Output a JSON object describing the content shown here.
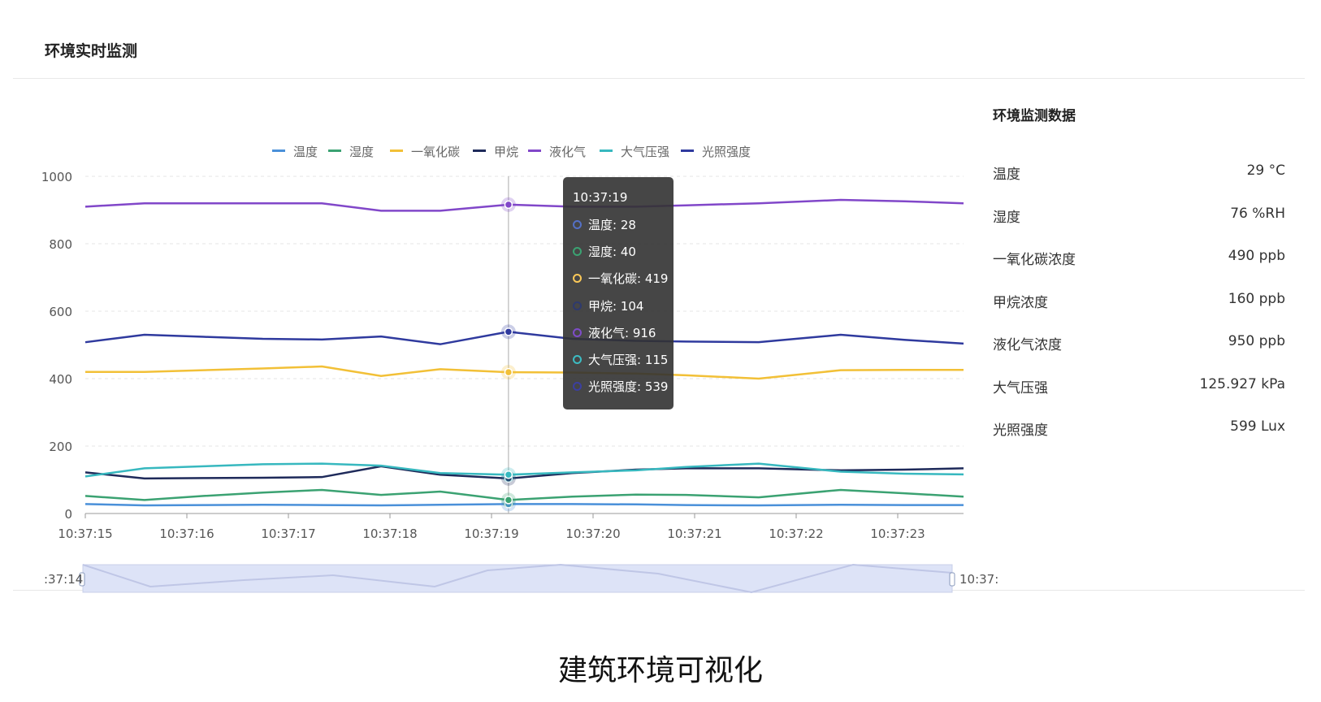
{
  "panel": {
    "title": "环境实时监测"
  },
  "caption": "建筑环境可视化",
  "side_panel": {
    "title": "环境监测数据",
    "rows": [
      {
        "label": "温度",
        "value": "29 °C"
      },
      {
        "label": "湿度",
        "value": "76 %RH"
      },
      {
        "label": "一氧化碳浓度",
        "value": "490 ppb"
      },
      {
        "label": "甲烷浓度",
        "value": "160 ppb"
      },
      {
        "label": "液化气浓度",
        "value": "950 ppb"
      },
      {
        "label": "大气压强",
        "value": "125.927 kPa"
      },
      {
        "label": "光照强度",
        "value": "599 Lux"
      }
    ]
  },
  "tooltip": {
    "time": "10:37:19",
    "rows": [
      {
        "text": "温度: 28",
        "color": "#5470c6"
      },
      {
        "text": "湿度: 40",
        "color": "#3ba272"
      },
      {
        "text": "一氧化碳: 419",
        "color": "#fac858"
      },
      {
        "text": "甲烷: 104",
        "color": "#2e3a6e"
      },
      {
        "text": "液化气: 916",
        "color": "#7e4cc9"
      },
      {
        "text": "大气压强: 115",
        "color": "#3cbcc3"
      },
      {
        "text": "光照强度: 539",
        "color": "#3b3fa0"
      }
    ]
  },
  "zoom": {
    "start_label": ":37:14",
    "end_label": "10:37:"
  },
  "chart_data": {
    "type": "line",
    "ylim": [
      0,
      1000
    ],
    "yticks": [
      0,
      200,
      400,
      600,
      800,
      1000
    ],
    "x": [
      0,
      0.65,
      1.3,
      1.95,
      2.6,
      3.25,
      3.9,
      4.65,
      5.35,
      6.05,
      6.6,
      7.4,
      8.3,
      9.0,
      9.65
    ],
    "xticks": [
      "10:37:15",
      "10:37:16",
      "10:37:17",
      "10:37:18",
      "10:37:19",
      "10:37:20",
      "10:37:21",
      "10:37:22",
      "10:37:23"
    ],
    "grid": true,
    "legend_position": "top-center",
    "series": [
      {
        "name": "温度",
        "color": "#4a90d9",
        "values": [
          28,
          24,
          25,
          26,
          25,
          24,
          26,
          28,
          28,
          27,
          25,
          24,
          26,
          25,
          25
        ]
      },
      {
        "name": "湿度",
        "color": "#3ba272",
        "values": [
          52,
          40,
          52,
          62,
          70,
          55,
          65,
          40,
          50,
          56,
          55,
          48,
          70,
          60,
          50
        ]
      },
      {
        "name": "一氧化碳",
        "color": "#f2c037",
        "values": [
          420,
          420,
          425,
          430,
          436,
          408,
          428,
          419,
          418,
          415,
          410,
          400,
          425,
          426,
          426
        ]
      },
      {
        "name": "甲烷",
        "color": "#1e2a5a",
        "values": [
          122,
          104,
          105,
          106,
          108,
          140,
          115,
          104,
          120,
          130,
          134,
          134,
          128,
          130,
          134
        ]
      },
      {
        "name": "液化气",
        "color": "#8147c9",
        "values": [
          910,
          920,
          920,
          920,
          920,
          898,
          898,
          916,
          910,
          910,
          914,
          920,
          930,
          926,
          920
        ]
      },
      {
        "name": "大气压强",
        "color": "#37b8bf",
        "values": [
          110,
          134,
          140,
          146,
          148,
          142,
          120,
          115,
          122,
          128,
          138,
          148,
          124,
          118,
          116
        ]
      },
      {
        "name": "光照强度",
        "color": "#2f3a9e",
        "values": [
          508,
          530,
          524,
          518,
          516,
          525,
          502,
          539,
          518,
          512,
          510,
          508,
          530,
          515,
          504
        ]
      }
    ]
  }
}
